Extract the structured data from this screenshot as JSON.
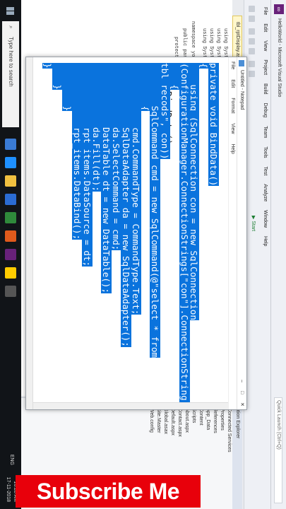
{
  "vs": {
    "window_title": "HelloWorld - Microsoft Visual Studio",
    "quick_launch": "Quick Launch (Ctrl+Q)",
    "menu": [
      "File",
      "Edit",
      "View",
      "Project",
      "Build",
      "Debug",
      "Team",
      "Tools",
      "Test",
      "Analyze",
      "Window",
      "Help"
    ],
    "start_button": "Start",
    "editor_tab": "tbl_rptDisplay.aspx.cs",
    "code_lines": [
      "using System;",
      "using System.Data;",
      "using System.Linq;",
      "using System.Web;",
      "namespace your_",
      "public partial",
      "protected void",
      "this.BindData();"
    ],
    "solution_explorer": {
      "title": "Solution Explorer",
      "items": [
        "Connected Services",
        "Properties",
        "References",
        "App_Data",
        "Content",
        "Scripts",
        "About.aspx",
        "Contact.aspx",
        "Default.aspx",
        "Global.asax",
        "Site.Master",
        "Web.config"
      ]
    }
  },
  "notepad": {
    "title": "Untitled - Notepad",
    "menu": [
      "File",
      "Edit",
      "Format",
      "View",
      "Help"
    ],
    "window_buttons": [
      "–",
      "□",
      "✕"
    ],
    "brace_close": "}",
    "bind_call": "this.BindData();",
    "selected_lines": [
      "private void BindData()",
      "{",
      "    using (SqlConnection con = new SqlConnection",
      "(ConfigurationManager.ConnectionStrings[\"con\"].ConnectionString))",
      "    {",
      "tbl_recods\", con))",
      "        SqlCommand cmd = new SqlCommand(@\"select * from",
      "        {",
      "            cmd.CommandType = CommandType.Text;",
      "            SqlDataAdapter da = new SqlDataAdapter();",
      "            da.SelectCommand = cmd;",
      "            DataTable dt = new DataTable();",
      "            da.Fill(dt);",
      "            rpt_items.DataSource = dt;",
      "            rpt_items.DataBind();",
      "        }",
      "    }",
      "}"
    ]
  },
  "taskbar": {
    "search_placeholder": "Type here to search",
    "language": "ENG",
    "time": "10:28 AM",
    "date": "17-11-2018"
  },
  "banner": {
    "text": "Subscribe Me",
    "color": "#e8000b"
  },
  "colors": {
    "selection": "#0a73dd",
    "taskbar": "#111418"
  }
}
